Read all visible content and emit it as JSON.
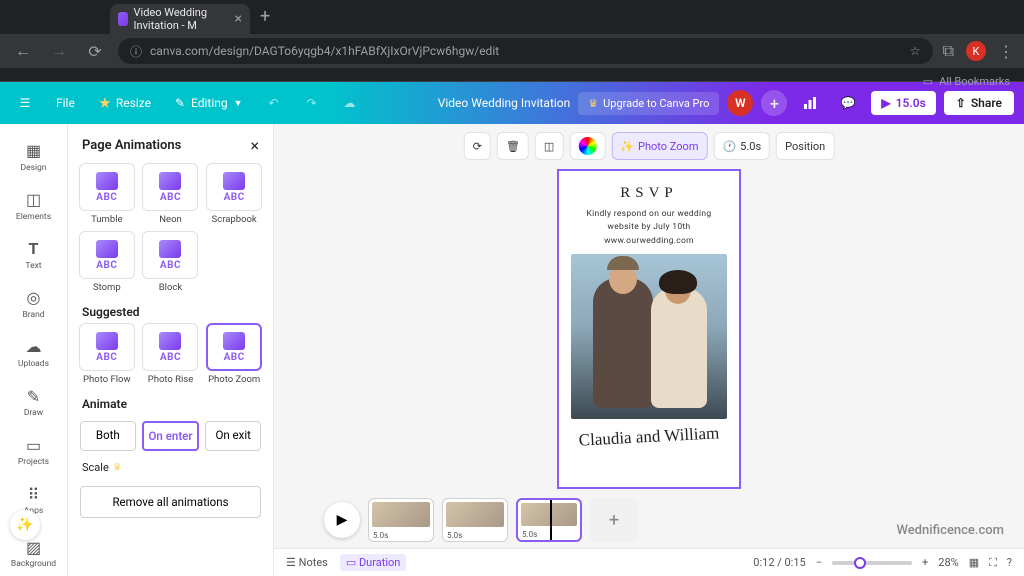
{
  "browser": {
    "tab_title": "Video Wedding Invitation - M",
    "url": "canva.com/design/DAGTo6yqgb4/x1hFABfXjIxOrVjPcw6hgw/edit",
    "bookmarks_label": "All Bookmarks",
    "avatar": "K"
  },
  "header": {
    "file": "File",
    "resize": "Resize",
    "editing": "Editing",
    "doc_title": "Video Wedding Invitation",
    "upgrade": "Upgrade to Canva Pro",
    "avatar": "W",
    "play_duration": "15.0s",
    "share": "Share"
  },
  "rail": {
    "design": "Design",
    "elements": "Elements",
    "text": "Text",
    "brand": "Brand",
    "uploads": "Uploads",
    "draw": "Draw",
    "projects": "Projects",
    "apps": "Apps",
    "background": "Background"
  },
  "panel": {
    "title": "Page Animations",
    "row1": {
      "a": "Tumble",
      "b": "Neon",
      "c": "Scrapbook"
    },
    "row2": {
      "a": "Stomp",
      "b": "Block"
    },
    "suggested": "Suggested",
    "row3": {
      "a": "Photo Flow",
      "b": "Photo Rise",
      "c": "Photo Zoom"
    },
    "abc": "ABC",
    "animate": "Animate",
    "both": "Both",
    "on_enter": "On enter",
    "on_exit": "On exit",
    "scale": "Scale",
    "remove": "Remove all animations"
  },
  "context": {
    "photo_zoom": "Photo Zoom",
    "duration": "5.0s",
    "position": "Position"
  },
  "page": {
    "rsvp": "RSVP",
    "body": "Kindly respond on our wedding website by July 10th",
    "site": "www.ourwedding.com",
    "signature": "Claudia and William"
  },
  "timeline": {
    "dur1": "5.0s",
    "dur2": "5.0s",
    "dur3": "5.0s"
  },
  "bottom": {
    "notes": "Notes",
    "duration": "Duration",
    "time": "0:12 / 0:15",
    "zoom": "28%"
  },
  "watermark": "Wednificence.com"
}
